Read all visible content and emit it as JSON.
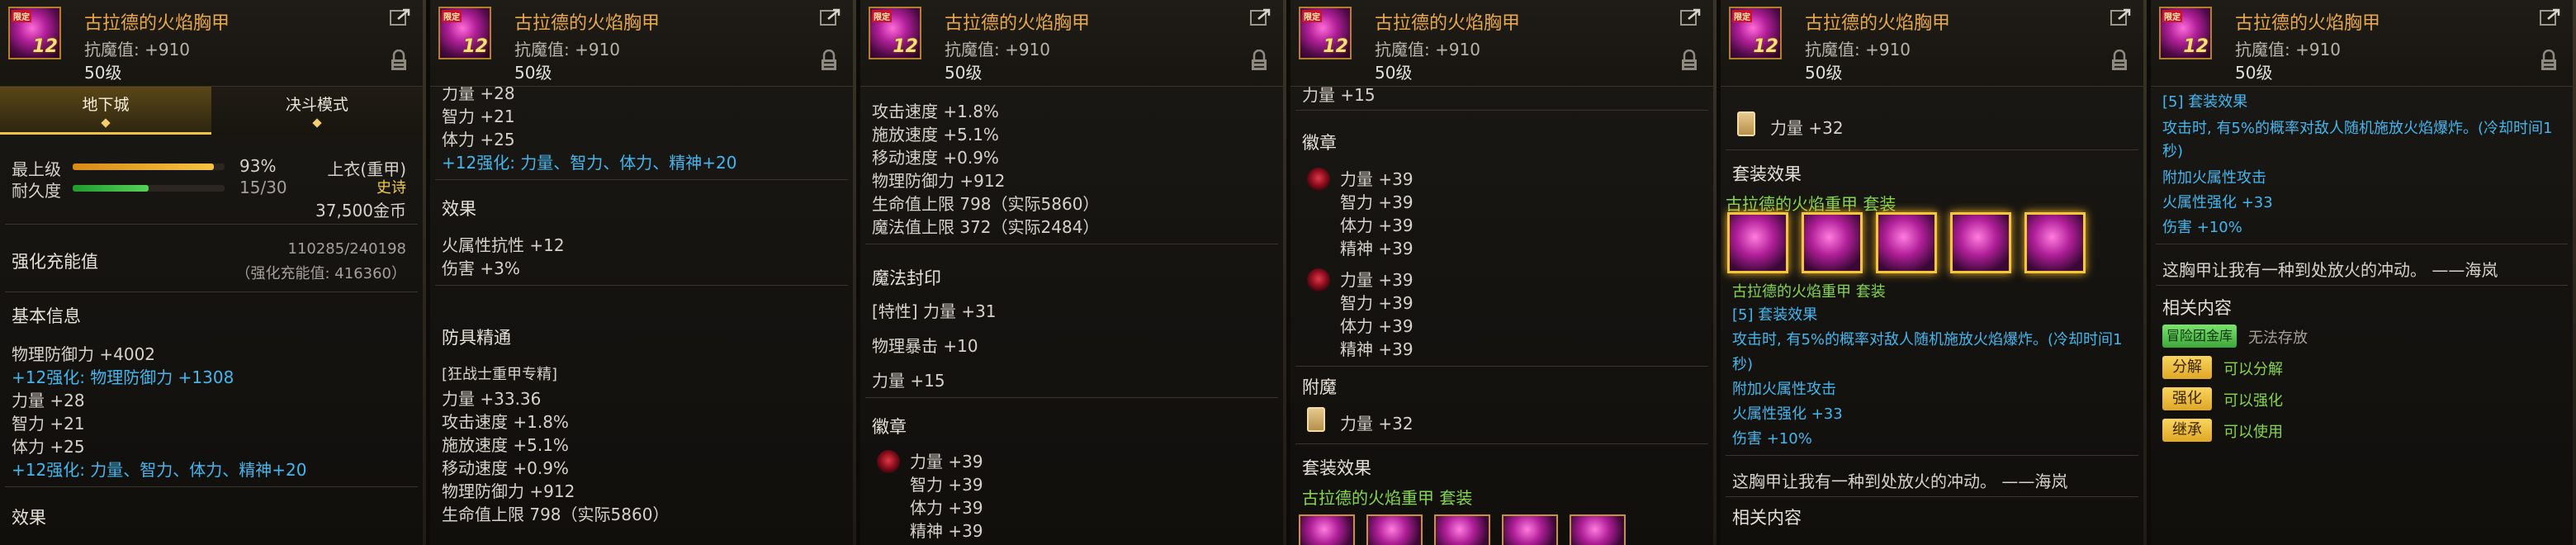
{
  "item": {
    "name": "古拉德的火焰胸甲",
    "resist": "抗魔值: +910",
    "level": "50级",
    "thumb_badge": "12",
    "thumb_tag": "限定"
  },
  "icons": {
    "share": "share-icon",
    "lock": "lock-icon"
  },
  "colors": {
    "title": "#e8a84a",
    "blue": "#44b6ee",
    "green": "#86d64c",
    "gold": "#f2cb3e"
  },
  "p1": {
    "tab_dungeon": "地下城",
    "tab_duel": "决斗模式",
    "max_level_label": "最上级",
    "max_level_value": "93%",
    "max_level_fraction": 0.93,
    "durability_label": "耐久度",
    "durability_value": "15/30",
    "durability_fraction": 0.5,
    "slot": "上衣(重甲)",
    "rarity": "史诗",
    "price": "37,500金币",
    "enhance_label": "强化充能值",
    "enhance_value": "110285/240198",
    "enhance_real": "（强化充能值: 416360）",
    "basic_info": "基本信息",
    "stats": [
      "物理防御力 +4002",
      "+12强化: 物理防御力 +1308",
      "力量 +28",
      "智力 +21",
      "体力 +25",
      "+12强化: 力量、智力、体力、精神+20"
    ],
    "effects": "效果"
  },
  "p2": {
    "top": [
      "力量 +28",
      "智力 +21",
      "体力 +25",
      "+12强化: 力量、智力、体力、精神+20"
    ],
    "effects": "效果",
    "effect_lines": [
      "火属性抗性 +12",
      "伤害 +3%"
    ],
    "mastery": "防具精通",
    "mastery_lines": [
      "[狂战士重甲专精]",
      "力量 +33.36",
      "攻击速度 +1.8%",
      "施放速度 +5.1%",
      "移动速度 +0.9%",
      "物理防御力 +912",
      "生命值上限 798（实际5860）"
    ]
  },
  "p3": {
    "lines": [
      "攻击速度 +1.8%",
      "施放速度 +5.1%",
      "移动速度 +0.9%",
      "物理防御力 +912",
      "生命值上限 798（实际5860）",
      "魔法值上限 372（实际2484）"
    ],
    "seal": "魔法封印",
    "seal_lines": [
      "[特性] 力量 +31",
      "物理暴击 +10",
      "力量 +15"
    ],
    "emblem": "徽章",
    "emblem_lines": [
      "力量 +39",
      "智力 +39",
      "体力 +39",
      "精神 +39"
    ]
  },
  "p4": {
    "top": "力量 +15",
    "emblem": "徽章",
    "emblem1": [
      "力量 +39",
      "智力 +39",
      "体力 +39",
      "精神 +39"
    ],
    "emblem2": [
      "力量 +39",
      "智力 +39",
      "体力 +39",
      "精神 +39"
    ],
    "enchant": "附魔",
    "enchant_line": "力量 +32",
    "set_effect": "套装效果",
    "set_name": "古拉德的火焰重甲 套装"
  },
  "p5": {
    "card_line": "力量 +32",
    "set_effect": "套装效果",
    "set_name": "古拉德的火焰重甲 套装",
    "set_name2": "古拉德的火焰重甲 套装",
    "set5": "[5] 套装效果",
    "set5_desc1": "攻击时, 有5%的概率对敌人随机施放火焰爆炸。(冷却时间1",
    "set5_desc2": "秒)",
    "lines": [
      "附加火属性攻击",
      "火属性强化 +33",
      "伤害 +10%"
    ],
    "quote": "这胸甲让我有一种到处放火的冲动。 ——海岚",
    "related": "相关内容"
  },
  "p6": {
    "set5": "[5] 套装效果",
    "set5_desc1": "攻击时, 有5%的概率对敌人随机施放火焰爆炸。(冷却时间1",
    "set5_desc2": "秒)",
    "lines": [
      "附加火属性攻击",
      "火属性强化 +33",
      "伤害 +10%"
    ],
    "quote": "这胸甲让我有一种到处放火的冲动。 ——海岚",
    "related": "相关内容",
    "buttons": [
      {
        "label": "冒险团金库",
        "text": "无法存放",
        "style": "green"
      },
      {
        "label": "分解",
        "text": "可以分解",
        "style": "gold"
      },
      {
        "label": "强化",
        "text": "可以强化",
        "style": "gold"
      },
      {
        "label": "继承",
        "text": "可以使用",
        "style": "gold"
      }
    ]
  }
}
